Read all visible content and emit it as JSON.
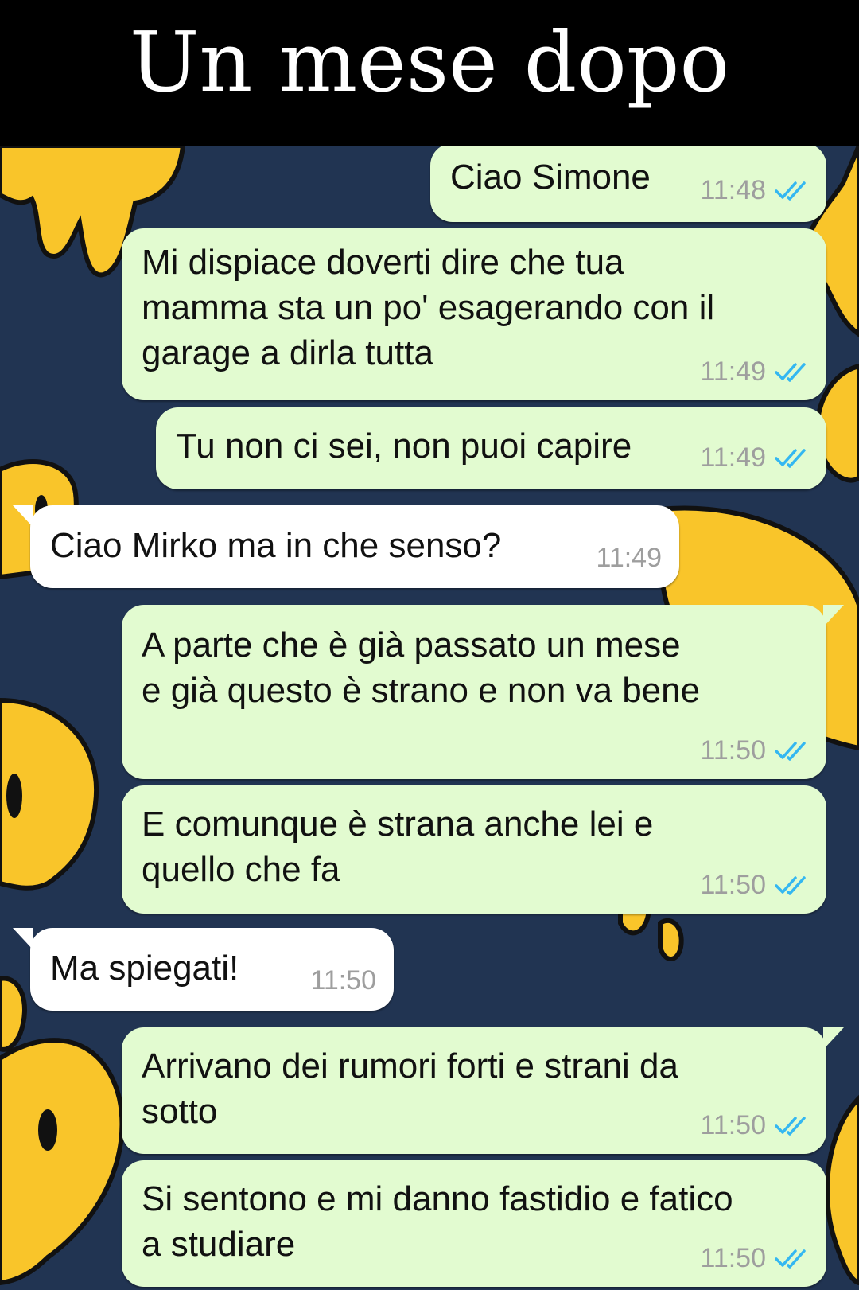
{
  "header": {
    "title": "Un mese dopo"
  },
  "colors": {
    "background": "#213452",
    "smiley_yellow": "#f9c52a",
    "outgoing_bubble": "#e2fbd0",
    "incoming_bubble": "#ffffff",
    "read_ticks": "#34b7f1",
    "timestamp": "#9e9e9e"
  },
  "messages": [
    {
      "direction": "out",
      "text": "Ciao Simone",
      "time": "11:48",
      "status": "read",
      "status_icon": "double-check-icon"
    },
    {
      "direction": "out",
      "text": "Mi dispiace doverti dire che tua\nmamma sta un po' esagerando con il\ngarage a dirla tutta",
      "time": "11:49",
      "status": "read",
      "status_icon": "double-check-icon"
    },
    {
      "direction": "out",
      "text": "Tu non ci sei, non puoi capire",
      "time": "11:49",
      "status": "read",
      "status_icon": "double-check-icon"
    },
    {
      "direction": "in",
      "text": "Ciao Mirko ma in che senso?",
      "time": "11:49"
    },
    {
      "direction": "out",
      "text": "A parte che è già passato un mese\ne già questo è strano e non va bene",
      "time": "11:50",
      "status": "read",
      "status_icon": "double-check-icon"
    },
    {
      "direction": "out",
      "text": "E comunque è strana anche lei e\nquello che fa",
      "time": "11:50",
      "status": "read",
      "status_icon": "double-check-icon"
    },
    {
      "direction": "in",
      "text": "Ma spiegati!",
      "time": "11:50"
    },
    {
      "direction": "out",
      "text": "Arrivano dei rumori forti e strani da\nsotto",
      "time": "11:50",
      "status": "read",
      "status_icon": "double-check-icon"
    },
    {
      "direction": "out",
      "text": "Si sentono e mi danno fastidio e fatico\na studiare",
      "time": "11:50",
      "status": "read",
      "status_icon": "double-check-icon"
    }
  ]
}
